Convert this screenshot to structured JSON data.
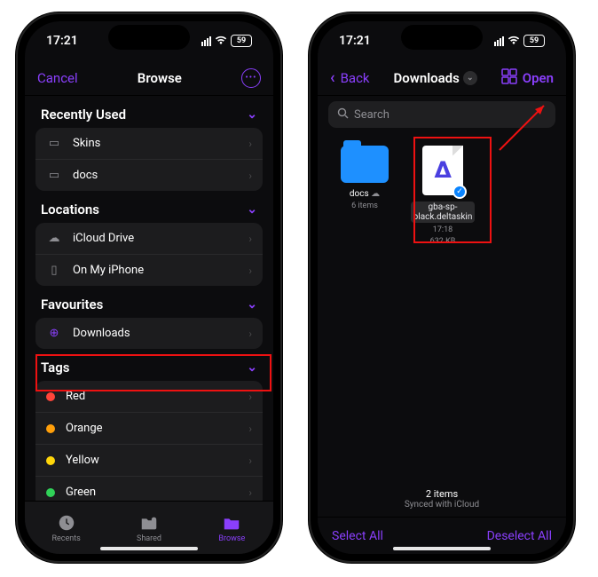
{
  "status": {
    "time": "17:21",
    "battery": "59"
  },
  "left_phone": {
    "nav": {
      "cancel": "Cancel",
      "title": "Browse"
    },
    "sections": {
      "recent": {
        "header": "Recently Used",
        "items": [
          "Skins",
          "docs"
        ]
      },
      "locations": {
        "header": "Locations",
        "items": [
          "iCloud Drive",
          "On My iPhone"
        ]
      },
      "favourites": {
        "header": "Favourites",
        "items": [
          "Downloads"
        ]
      },
      "tags": {
        "header": "Tags",
        "items": [
          "Red",
          "Orange",
          "Yellow",
          "Green"
        ]
      }
    },
    "tabs": {
      "recents": "Recents",
      "shared": "Shared",
      "browse": "Browse"
    }
  },
  "right_phone": {
    "nav": {
      "back": "Back",
      "title": "Downloads",
      "open": "Open"
    },
    "search_placeholder": "Search",
    "items": {
      "folder": {
        "name": "docs",
        "meta": "6 items"
      },
      "file": {
        "name": "gba-sp-black.deltaskin",
        "time": "17:18",
        "size": "632 KB"
      }
    },
    "footer": {
      "count": "2 items",
      "sync": "Synced with iCloud"
    },
    "bottom": {
      "select_all": "Select All",
      "deselect_all": "Deselect All"
    }
  }
}
